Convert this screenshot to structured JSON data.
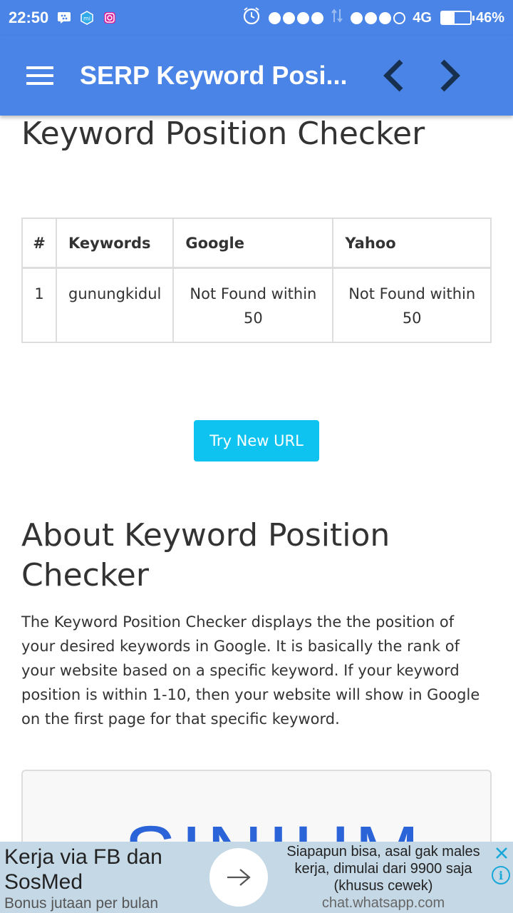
{
  "status_bar": {
    "time": "22:50",
    "network": "4G",
    "battery_percent": "46%",
    "battery_level": 0.46,
    "left_icons": [
      "bbm-icon",
      "mi-icon",
      "instagram-icon"
    ],
    "right_icons": [
      "alarm-icon",
      "signal-dots-icon",
      "data-arrows-icon",
      "signal-dots-icon",
      "battery-icon"
    ]
  },
  "app_bar": {
    "title": "SERP Keyword Posi...",
    "menu_icon": "menu-icon",
    "back_icon": "chevron-left-icon",
    "forward_icon": "chevron-right-icon",
    "color": "#4a84e6"
  },
  "page": {
    "heading": "Keyword Position Checker",
    "table": {
      "headers": [
        "#",
        "Keywords",
        "Google",
        "Yahoo"
      ],
      "rows": [
        [
          "1",
          "gunungkidul",
          "Not Found within 50",
          "Not Found within 50"
        ]
      ]
    },
    "try_button": "Try New URL",
    "button_color": "#0ec3f0",
    "about_heading": "About Keyword Position Checker",
    "about_text": "The Keyword Position Checker displays the the position of your desired keywords in Google. It is basically the rank of your website based on a specific keyword. If your keyword position is within 1-10, then your website will show in Google on the first page for that specific keyword.",
    "logo_text": "SINIUM"
  },
  "ad": {
    "title": "Kerja via FB dan SosMed",
    "subtitle": "Bonus jutaan per bulan",
    "description": "Siapapun bisa, asal gak males kerja, dimulai dari 9900 saja (khusus cewek)",
    "url": "chat.whatsapp.com",
    "arrow_icon": "arrow-right-icon",
    "close_icon": "close-icon",
    "info_icon": "info-icon",
    "info_glyph": "i"
  }
}
